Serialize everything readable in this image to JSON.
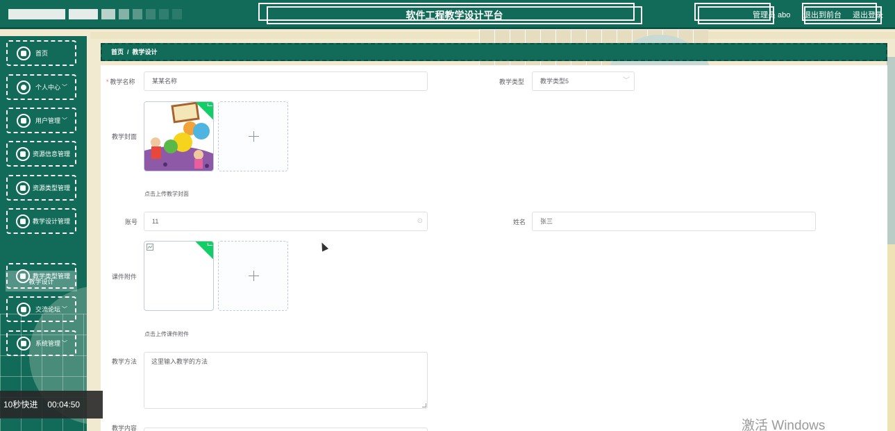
{
  "header": {
    "title": "软件工程教学设计平台",
    "user_text": "管理员 abo",
    "back_front": "退出到前台",
    "logout": "退出登录"
  },
  "sidebar": {
    "items": [
      {
        "label": "首页",
        "icon": "home-icon",
        "chevron": false
      },
      {
        "label": "个人中心",
        "icon": "user-icon",
        "chevron": true
      },
      {
        "label": "用户管理",
        "icon": "users-icon",
        "chevron": true
      },
      {
        "label": "资源信息管理",
        "icon": "resource-icon",
        "chevron": false
      },
      {
        "label": "资源类型管理",
        "icon": "category-icon",
        "chevron": false
      },
      {
        "label": "教学设计管理",
        "icon": "design-icon",
        "chevron": false
      },
      {
        "label": "教学类型管理",
        "icon": "type-icon",
        "chevron": false
      },
      {
        "label": "交流论坛",
        "icon": "forum-icon",
        "chevron": true
      },
      {
        "label": "系统管理",
        "icon": "settings-icon",
        "chevron": true
      }
    ],
    "active_sub": "教学设计"
  },
  "breadcrumb": {
    "home": "首页",
    "sep": "/",
    "current": "教学设计"
  },
  "form": {
    "name_label": "教学名称",
    "name_value": "某某名称",
    "type_label": "教学类型",
    "type_value": "教学类型5",
    "cover_label": "教学封面",
    "cover_tip": "点击上传教学封面",
    "account_label": "账号",
    "account_value": "11",
    "realname_label": "姓名",
    "realname_value": "张三",
    "attach_label": "课件附件",
    "attach_tip": "点击上传课件附件",
    "method_label": "教学方法",
    "method_value": "这里输入教学的方法",
    "content_label": "教学内容"
  },
  "video": {
    "label": "10秒快进",
    "time": "00:04:50"
  },
  "watermark": "激活 Windows",
  "colors": {
    "primary": "#116b58",
    "success": "#13ce66",
    "required": "#f56c6c"
  }
}
